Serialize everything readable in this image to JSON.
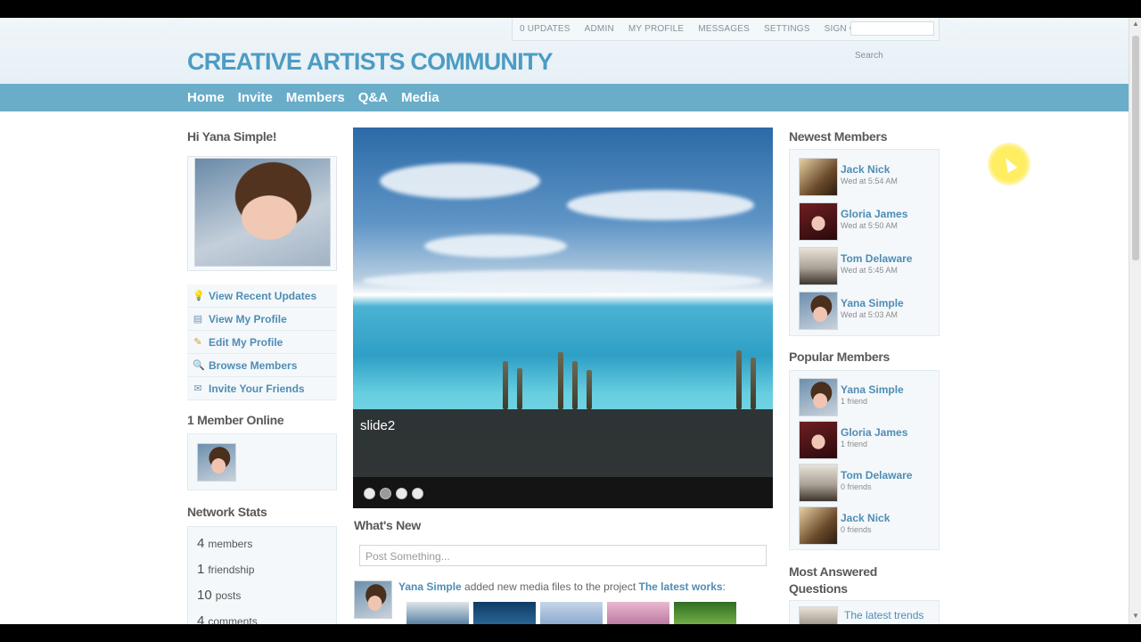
{
  "topnav": {
    "items": [
      "0 UPDATES",
      "ADMIN",
      "MY PROFILE",
      "MESSAGES",
      "SETTINGS",
      "SIGN OUT"
    ],
    "search_label": "Search"
  },
  "logo": "CREATIVE ARTISTS COMMUNITY",
  "mainnav": [
    "Home",
    "Invite",
    "Members",
    "Q&A",
    "Media"
  ],
  "left": {
    "greeting": "Hi Yana Simple!",
    "menu": [
      {
        "label": "View Recent Updates",
        "icon": "lightbulb-icon"
      },
      {
        "label": "View My Profile",
        "icon": "profile-icon"
      },
      {
        "label": "Edit My Profile",
        "icon": "pencil-icon"
      },
      {
        "label": "Browse Members",
        "icon": "magnifier-icon"
      },
      {
        "label": "Invite Your Friends",
        "icon": "envelope-icon"
      }
    ],
    "online_title": "1 Member Online",
    "stats_title": "Network Stats",
    "stats": [
      {
        "n": "4",
        "t": "members"
      },
      {
        "n": "1",
        "t": "friendship"
      },
      {
        "n": "10",
        "t": "posts"
      },
      {
        "n": "4",
        "t": "comments"
      }
    ]
  },
  "slider": {
    "caption": "slide2",
    "dots": 4,
    "active_dot": 2
  },
  "whats_new": {
    "title": "What's New",
    "placeholder": "Post Something...",
    "activity": {
      "who": "Yana Simple",
      "text": "added new media files to the project",
      "project": "The latest works",
      "suffix": ":"
    }
  },
  "right": {
    "newest_title": "Newest Members",
    "newest": [
      {
        "name": "Jack Nick",
        "sub": "Wed at 5:54 AM"
      },
      {
        "name": "Gloria James",
        "sub": "Wed at 5:50 AM"
      },
      {
        "name": "Tom Delaware",
        "sub": "Wed at 5:45 AM"
      },
      {
        "name": "Yana Simple",
        "sub": "Wed at 5:03 AM"
      }
    ],
    "popular_title": "Popular Members",
    "popular": [
      {
        "name": "Yana Simple",
        "sub": "1 friend"
      },
      {
        "name": "Gloria James",
        "sub": "1 friend"
      },
      {
        "name": "Tom Delaware",
        "sub": "0 friends"
      },
      {
        "name": "Jack Nick",
        "sub": "0 friends"
      }
    ],
    "answered_title": "Most Answered Questions",
    "question": "The latest trends"
  },
  "colors": {
    "brand": "#4d9cc3",
    "nav": "#69adc9",
    "link": "#4f8db3"
  }
}
